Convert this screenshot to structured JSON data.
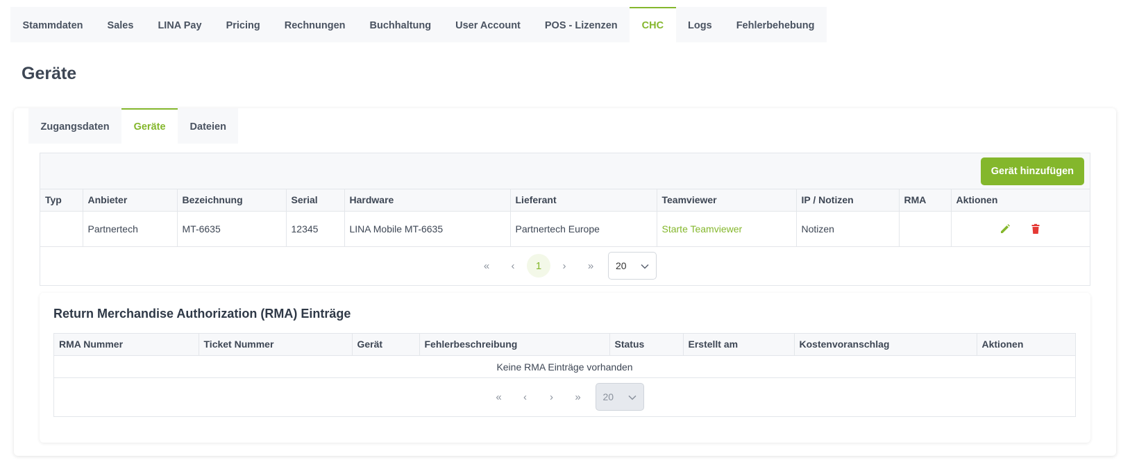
{
  "top_nav": {
    "tabs": [
      {
        "label": "Stammdaten",
        "active": false
      },
      {
        "label": "Sales",
        "active": false
      },
      {
        "label": "LINA Pay",
        "active": false
      },
      {
        "label": "Pricing",
        "active": false
      },
      {
        "label": "Rechnungen",
        "active": false
      },
      {
        "label": "Buchhaltung",
        "active": false
      },
      {
        "label": "User Account",
        "active": false
      },
      {
        "label": "POS - Lizenzen",
        "active": false
      },
      {
        "label": "CHC",
        "active": true
      },
      {
        "label": "Logs",
        "active": false
      },
      {
        "label": "Fehlerbehebung",
        "active": false
      }
    ]
  },
  "page": {
    "title": "Geräte"
  },
  "sub_nav": {
    "tabs": [
      {
        "label": "Zugangsdaten",
        "active": false
      },
      {
        "label": "Geräte",
        "active": true
      },
      {
        "label": "Dateien",
        "active": false
      }
    ]
  },
  "devices": {
    "add_button": "Gerät hinzufügen",
    "columns": [
      "Typ",
      "Anbieter",
      "Bezeichnung",
      "Serial",
      "Hardware",
      "Lieferant",
      "Teamviewer",
      "IP / Notizen",
      "RMA",
      "Aktionen"
    ],
    "rows": [
      {
        "typ": "",
        "anbieter": "Partnertech",
        "bezeichnung": "MT-6635",
        "serial": "12345",
        "hardware": "LINA Mobile MT-6635",
        "lieferant": "Partnertech Europe",
        "teamviewer": "Starte Teamviewer",
        "ip_notizen": "Notizen",
        "rma": ""
      }
    ],
    "pagination": {
      "first": "«",
      "prev": "‹",
      "current": "1",
      "next": "›",
      "last": "»",
      "page_size": "20"
    }
  },
  "rma": {
    "title": "Return Merchandise Authorization (RMA) Einträge",
    "columns": [
      "RMA Nummer",
      "Ticket Nummer",
      "Gerät",
      "Fehlerbeschreibung",
      "Status",
      "Erstellt am",
      "Kostenvoranschlag",
      "Aktionen"
    ],
    "empty_text": "Keine RMA Einträge vorhanden",
    "pagination": {
      "first": "«",
      "prev": "‹",
      "next": "›",
      "last": "»",
      "page_size": "20"
    }
  },
  "colors": {
    "accent": "#84b72c",
    "danger": "#e53935"
  }
}
